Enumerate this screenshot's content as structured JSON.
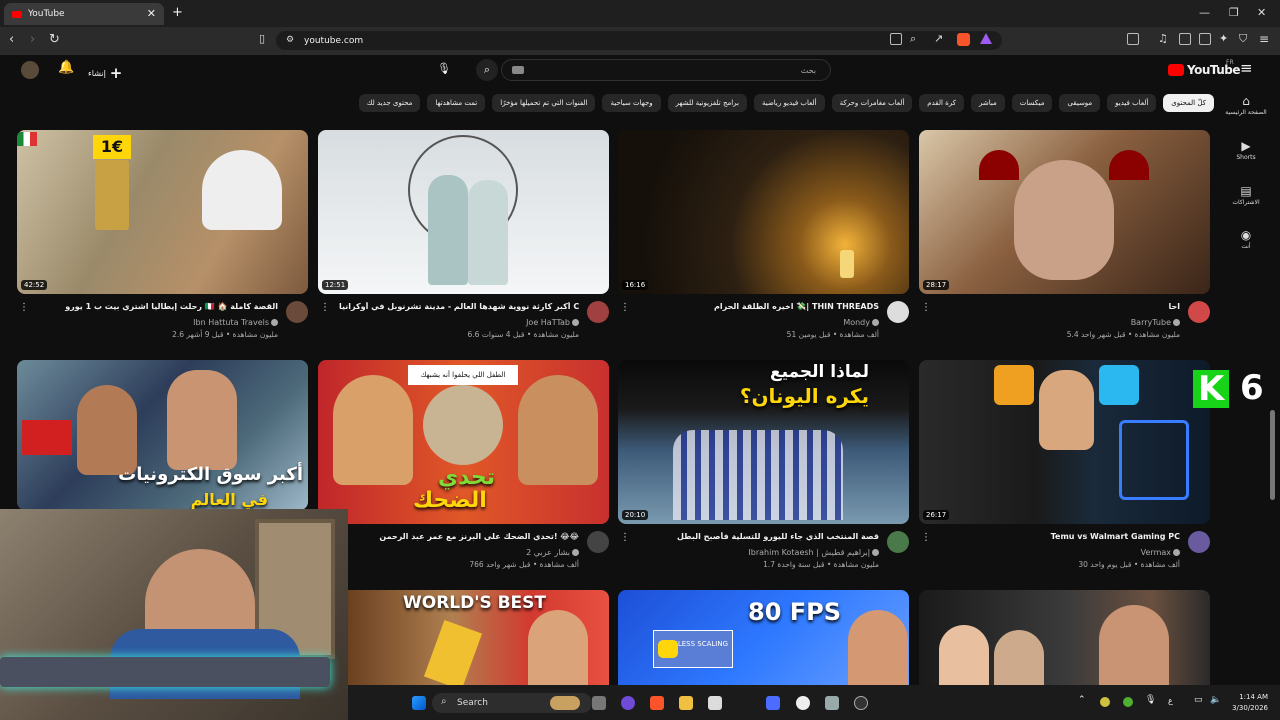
{
  "browser": {
    "tab_title": "YouTube",
    "url": "youtube.com"
  },
  "yt": {
    "logo_text": "YouTube",
    "logo_region": "FR",
    "create_label": "إنشاء",
    "search_placeholder": "بحث",
    "chips": [
      "كلّ المحتوى",
      "ألعاب فيديو",
      "موسيقى",
      "ميكسات",
      "مباشر",
      "كرة القدم",
      "ألعاب مغامرات وحركة",
      "ألعاب فيديو رياضية",
      "برامج تلفزيونية للشهر",
      "وجهات سياحية",
      "الفنوات التي تم تحميلها مؤخرًا",
      "تمت مشاهدتها",
      "محتوى جديد لك"
    ],
    "sidebar": [
      {
        "icon": "home-icon",
        "label": "الصفحة الرئيسية"
      },
      {
        "icon": "shorts-icon",
        "label": "Shorts"
      },
      {
        "icon": "subscriptions-icon",
        "label": "الاشتراكات"
      },
      {
        "icon": "you-icon",
        "label": "أنت"
      }
    ]
  },
  "videos": [
    {
      "title": "احا",
      "channel": "BarryTube",
      "meta": "5.4 مليون مشاهدة • قبل شهر واحد",
      "duration": "28:17"
    },
    {
      "title": "اخيره الطلقة الحرام 💸| THIN THREADS",
      "channel": "Mondy",
      "meta": "51 ألف مشاهدة • قبل يومين",
      "duration": "16:16"
    },
    {
      "title": "أكبر كارثة نووية شهدها العالم - مدينة تشرنوبل في أوكرانيا Chernobyl 🇺🇦",
      "channel": "Joe HaTTab",
      "meta": "6.6 مليون مشاهدة • قبل 4 سنوات",
      "duration": "12:51"
    },
    {
      "title": "رحلت إيطاليا اشتري بيت ب 1 يورو 🇮🇹 🏠 القصة كاملة",
      "channel": "Ibn Hattuta Travels",
      "meta": "2.6 مليون مشاهدة • قبل 9 أشهر",
      "duration": "42:52"
    },
    {
      "title": "Temu vs Walmart Gaming PC",
      "channel": "Vermax",
      "meta": "30 ألف مشاهدة • قبل يوم واحد",
      "duration": "26:17"
    },
    {
      "title": "قصة المنتخب الذي جاء لليورو للتسلية فأصبح البطل",
      "channel": "Ibrahim Kotaesh | إبراهيم قطيش",
      "meta": "1.7 مليون مشاهدة • قبل سنة واحدة",
      "duration": "20:10"
    },
    {
      "title": "تحدي الضحك علي البرنز مع عمر عبد الرحمن! 😂😂",
      "channel": "بشار عربي 2",
      "meta": "766 ألف مشاهدة • قبل شهر واحد",
      "duration": ""
    }
  ],
  "overlays": {
    "italy_price": "1€",
    "kotaesh_line1": "لماذا الجميع",
    "kotaesh_line2": "يكره اليونان؟",
    "laugh_caption": "الطفل اللي يحلفوا أنه يشبهك",
    "laugh_line1": "تحدي",
    "laugh_line2": "الضحك",
    "china_text1": "أكبر سوق الكترونيات",
    "china_text2": "في العالم",
    "temu_number": "6",
    "worlds_best": "WORLD'S BEST",
    "fps_text": "80 FPS",
    "lossless_text": "LOSSLESS SCALING"
  },
  "taskbar": {
    "search_label": "Search",
    "time": "1:14 AM",
    "date": "3/30/2026"
  },
  "colors": {
    "yt_red": "#ff0000",
    "background": "#0f0f0f",
    "chip_bg": "#272727"
  }
}
